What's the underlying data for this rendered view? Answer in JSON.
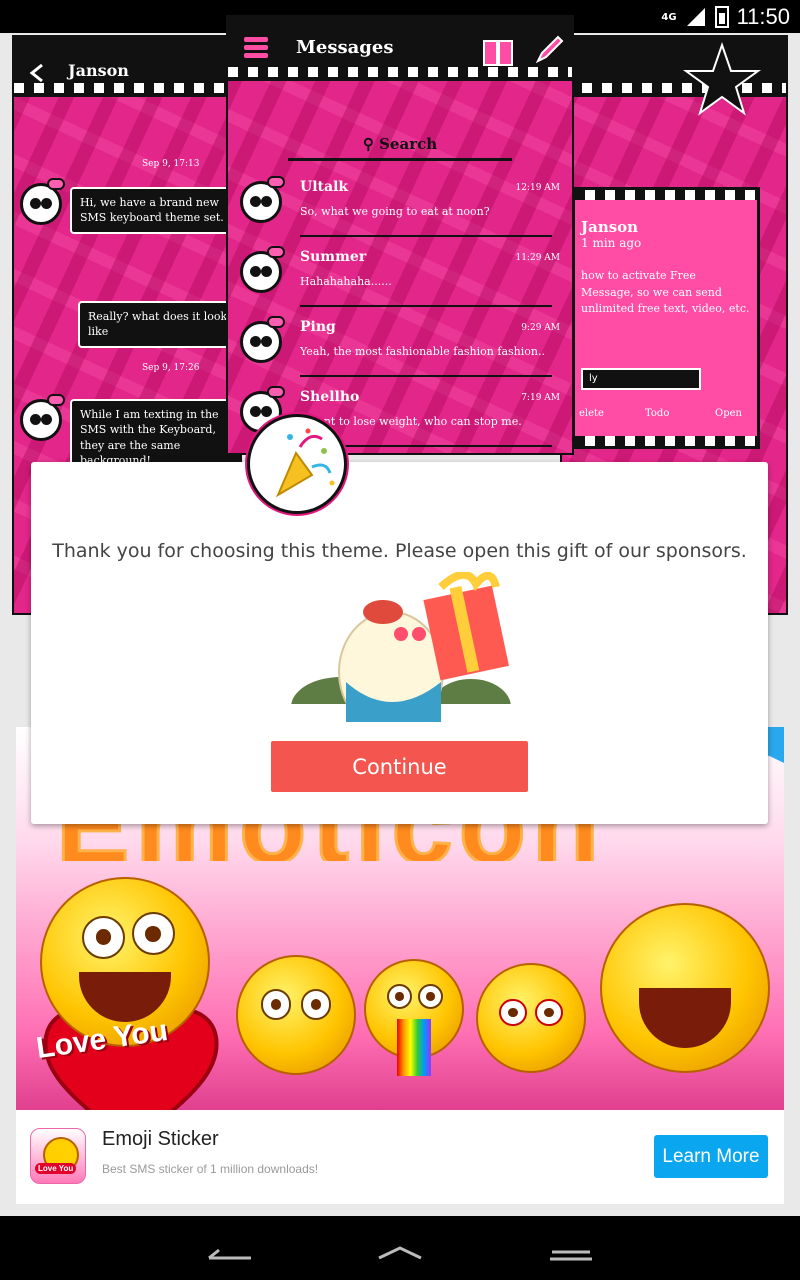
{
  "status_bar": {
    "time": "11:50",
    "network": "4G"
  },
  "theme_preview": {
    "left": {
      "contact": "Janson",
      "date1": "Sep 9, 17:13",
      "bubble1": "Hi, we have a brand new SMS keyboard theme set.",
      "bubble2": "Really? what does it look like",
      "date2": "Sep 9, 17:26",
      "bubble3": "While I am texting in the SMS with the Keyboard, they are the same background!"
    },
    "center": {
      "title": "Messages",
      "search": "Search",
      "messages": [
        {
          "name": "Ultalk",
          "time": "12:19 AM",
          "body": "So, what we going to eat at noon?"
        },
        {
          "name": "Summer",
          "time": "11:29 AM",
          "body": "Hahahahaha......"
        },
        {
          "name": "Ping",
          "time": "9:29 AM",
          "body": "Yeah, the most fashionable fashion fashion.."
        },
        {
          "name": "Shellho",
          "time": "7:19 AM",
          "body": "I want to lose weight, who can stop me."
        }
      ]
    },
    "right": {
      "contact": "Janson",
      "ago": "1 min ago",
      "body": "how to activate Free Message, so we can send unlimited free text, video, etc.",
      "reply": "ly",
      "delete": "elete",
      "todo": "Todo",
      "open": "Open"
    }
  },
  "dialog": {
    "message": "Thank you for choosing this theme. Please open this gift of our sponsors.",
    "continue_label": "Continue"
  },
  "ad": {
    "banner_text": "Emoticon",
    "banner_heart_text": "Love You",
    "app_title": "Emoji Sticker",
    "app_subtitle": "Best SMS sticker of 1 million downloads!",
    "cta_label": "Learn More"
  },
  "colors": {
    "theme_pink": "#e0187e",
    "continue_red": "#f4564f",
    "cta_blue": "#0aa6ef"
  }
}
